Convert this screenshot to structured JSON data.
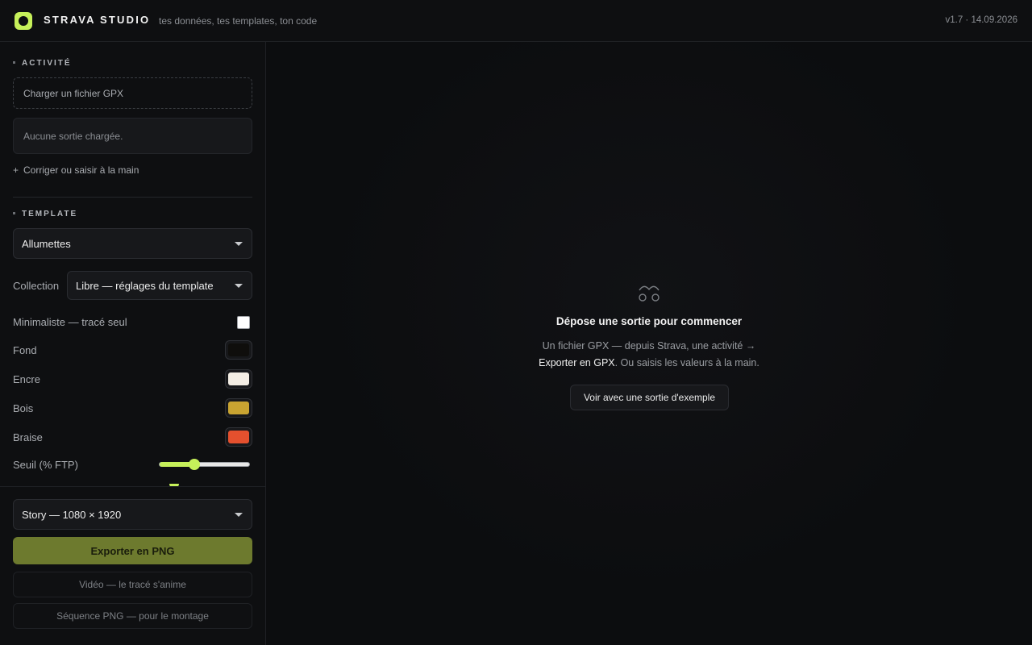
{
  "header": {
    "brand": "STRAVA STUDIO",
    "tagline": "tes données, tes templates, ton code",
    "version": "v1.7 · 14.09.2026"
  },
  "sidebar": {
    "activity": {
      "label": "ACTIVITÉ",
      "upload_label": "Charger un fichier GPX",
      "status": "Aucune sortie chargée.",
      "manual_plus": "+",
      "manual_label": "Corriger ou saisir à la main"
    },
    "template": {
      "label": "TEMPLATE",
      "selected": "Allumettes",
      "collection_label": "Collection",
      "collection_selected": "Libre — réglages du template",
      "minimal_label": "Minimaliste — tracé seul",
      "minimal_checked": false,
      "colors": [
        {
          "label": "Fond",
          "value": "#0f0e0c"
        },
        {
          "label": "Encre",
          "value": "#f3ede4"
        },
        {
          "label": "Bois",
          "value": "#c9a431"
        },
        {
          "label": "Braise",
          "value": "#e4502e"
        }
      ],
      "threshold_label": "Seuil (% FTP)",
      "threshold_value_fraction": 0.39
    },
    "footer": {
      "format_selected": "Story — 1080 × 1920",
      "export_png": "Exporter en PNG",
      "export_video": "Vidéo — le tracé s'anime",
      "export_sequence": "Séquence PNG — pour le montage"
    }
  },
  "main": {
    "empty_title": "Dépose une sortie pour commencer",
    "empty_line1": "Un fichier GPX — depuis Strava, une activité →",
    "empty_line2_strong": "Exporter en GPX",
    "empty_line2_rest": ". Ou saisis les valeurs à la main.",
    "example_button": "Voir avec une sortie d'exemple"
  },
  "colors": {
    "accent": "#c6f05a",
    "export_button": "#6d7a2e"
  }
}
